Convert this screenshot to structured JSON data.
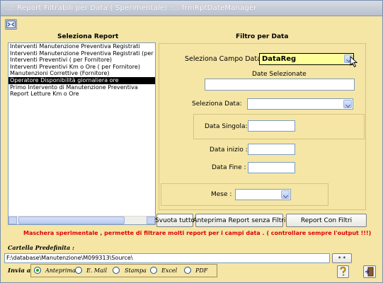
{
  "window": {
    "title": "..:: Report Filtrabili per Data ( Sperimentale) ::..   frmRptDateManager"
  },
  "toolbar": {
    "icon_name": "expand-icon"
  },
  "left": {
    "heading": "Seleziona Report",
    "reports": [
      "Interventi Manutenzione Preventiva Registrati",
      "Interventi Manutenzione Preventiva Registrati (per  Matric",
      "Interventi Preventivi  ( per Fornitore)",
      "Interventi Preventivi Km o Ore  ( per Fornitore)",
      "Manutenzioni Correttive (Fornitore)",
      "Operatore Disponibilità giornaliera ore",
      "Primo Intervento di Manutenzione Preventiva",
      "Report Letture Km o Ore"
    ],
    "selected_index": 5
  },
  "filter": {
    "heading": "Filtro per Data",
    "campo_label": "Seleziona Campo Data :",
    "campo_value": "DataReg",
    "date_selezionate_label": "Date Selezionate",
    "date_selezionate_value": "",
    "seleziona_data_label": "Seleziona Data:",
    "seleziona_data_value": "",
    "data_singola_label": "Data Singola:",
    "data_singola_value": "",
    "data_inizio_label": "Data inizio :",
    "data_inizio_value": "",
    "data_fine_label": "Data Fine :",
    "data_fine_value": "",
    "mese_label": "Mese :",
    "mese_value": ""
  },
  "buttons": {
    "svuota": "Svuota tutto",
    "anteprima_senza": "Anteprima Report senza Filtri",
    "report_con_filtri": "Report Con Filtri"
  },
  "warning": "Maschera sperimentale ,  permette di filtrare molti report per i campi data .  ( controllare sempre l'output !!!)",
  "folder": {
    "label": "Cartella Predefinita :",
    "path": "F:\\database\\Manutenzione\\M099313\\Source\\",
    "browse": "* *"
  },
  "send": {
    "label": "Invia a",
    "options": [
      "Anteprima",
      "E. Mail",
      "Stampa",
      "Excel",
      "PDF"
    ],
    "selected": "Anteprima"
  },
  "colors": {
    "form_bg": "#f5e6a6",
    "selected_combo_bg": "#ffff99",
    "warning_text": "#e00000"
  },
  "icons": [
    "help-icon",
    "exit-icon"
  ]
}
